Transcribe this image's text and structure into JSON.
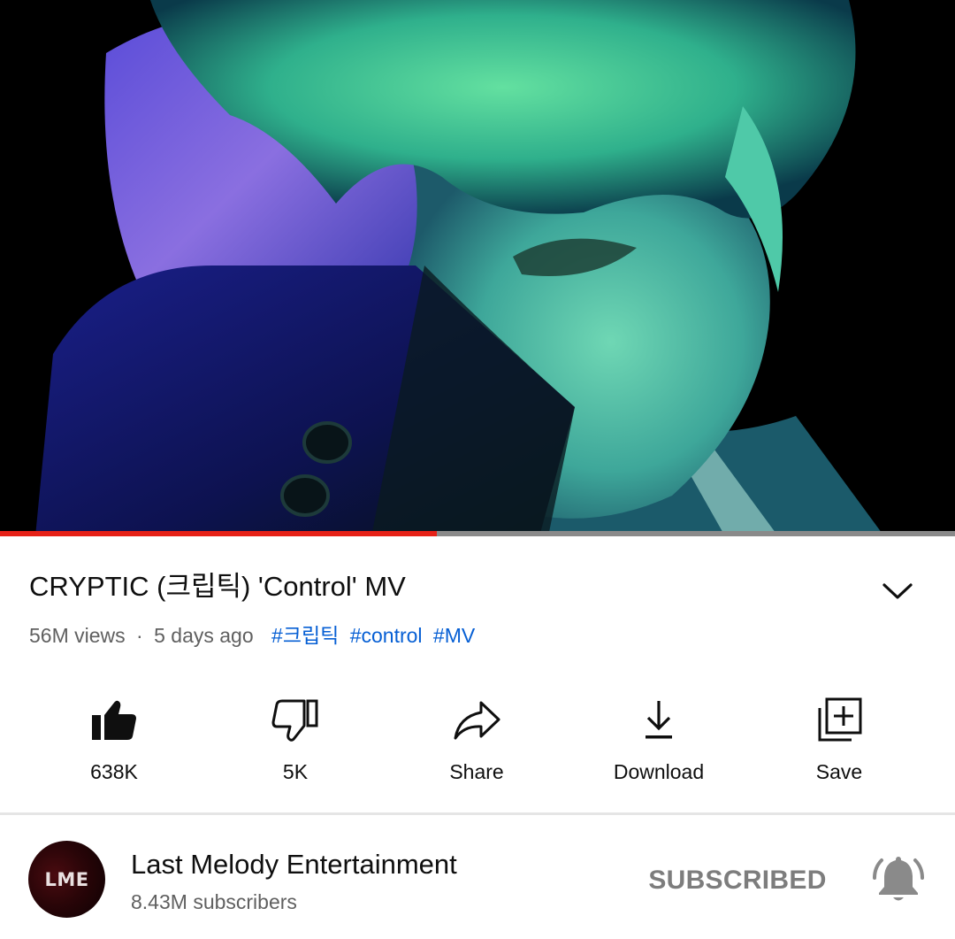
{
  "video": {
    "progress_fraction": 0.457,
    "colors": {
      "progress_played": "#e62117",
      "progress_remaining": "#8a8a8a"
    }
  },
  "title": {
    "text": "CRYPTIC (크립틱) 'Control' MV",
    "expand_icon": "chevron-down-icon"
  },
  "meta": {
    "views": "56M views",
    "separator": "·",
    "age": "5 days ago",
    "hashtags": [
      "#크립틱",
      "#control",
      "#MV"
    ],
    "hashtag_color": "#065fd4"
  },
  "actions": [
    {
      "icon": "thumbs-up-icon",
      "label": "638K"
    },
    {
      "icon": "thumbs-down-icon",
      "label": "5K"
    },
    {
      "icon": "share-icon",
      "label": "Share"
    },
    {
      "icon": "download-icon",
      "label": "Download"
    },
    {
      "icon": "save-playlist-icon",
      "label": "Save"
    }
  ],
  "channel": {
    "avatar_text": "LME",
    "name": "Last Melody Entertainment",
    "subscribers": "8.43M subscribers",
    "subscribe_label": "SUBSCRIBED",
    "bell_icon": "notification-bell-icon"
  }
}
